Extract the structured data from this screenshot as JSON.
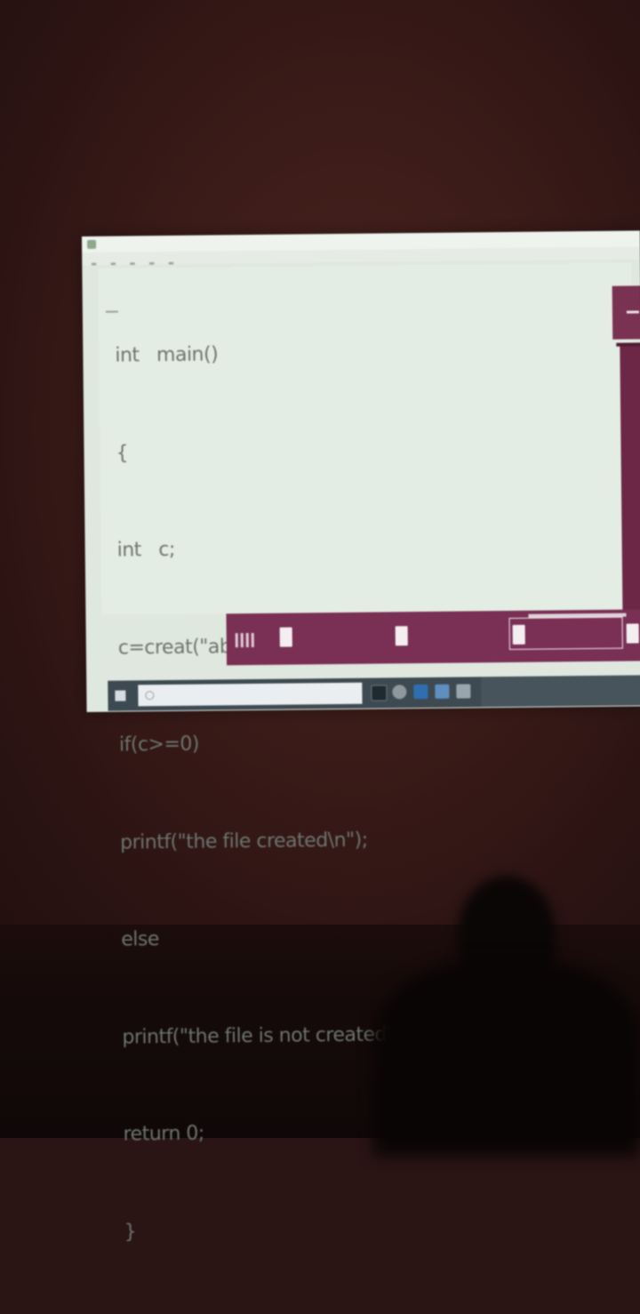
{
  "code_lines": [
    "int   main()",
    "{",
    "int   c;",
    "c=creat(\"abc.txt\", S_IRWXU);",
    "if(c>=0)",
    "printf(\"the file created\\n\");",
    "else",
    "printf(\"the file is not created\\n\");",
    "return 0;",
    "}"
  ],
  "colors": {
    "wall": "#3a1b18",
    "screen": "#dfe8de",
    "code_text": "#6d746d",
    "purple": "#7a2f55",
    "taskbar": "#3e4a52"
  }
}
